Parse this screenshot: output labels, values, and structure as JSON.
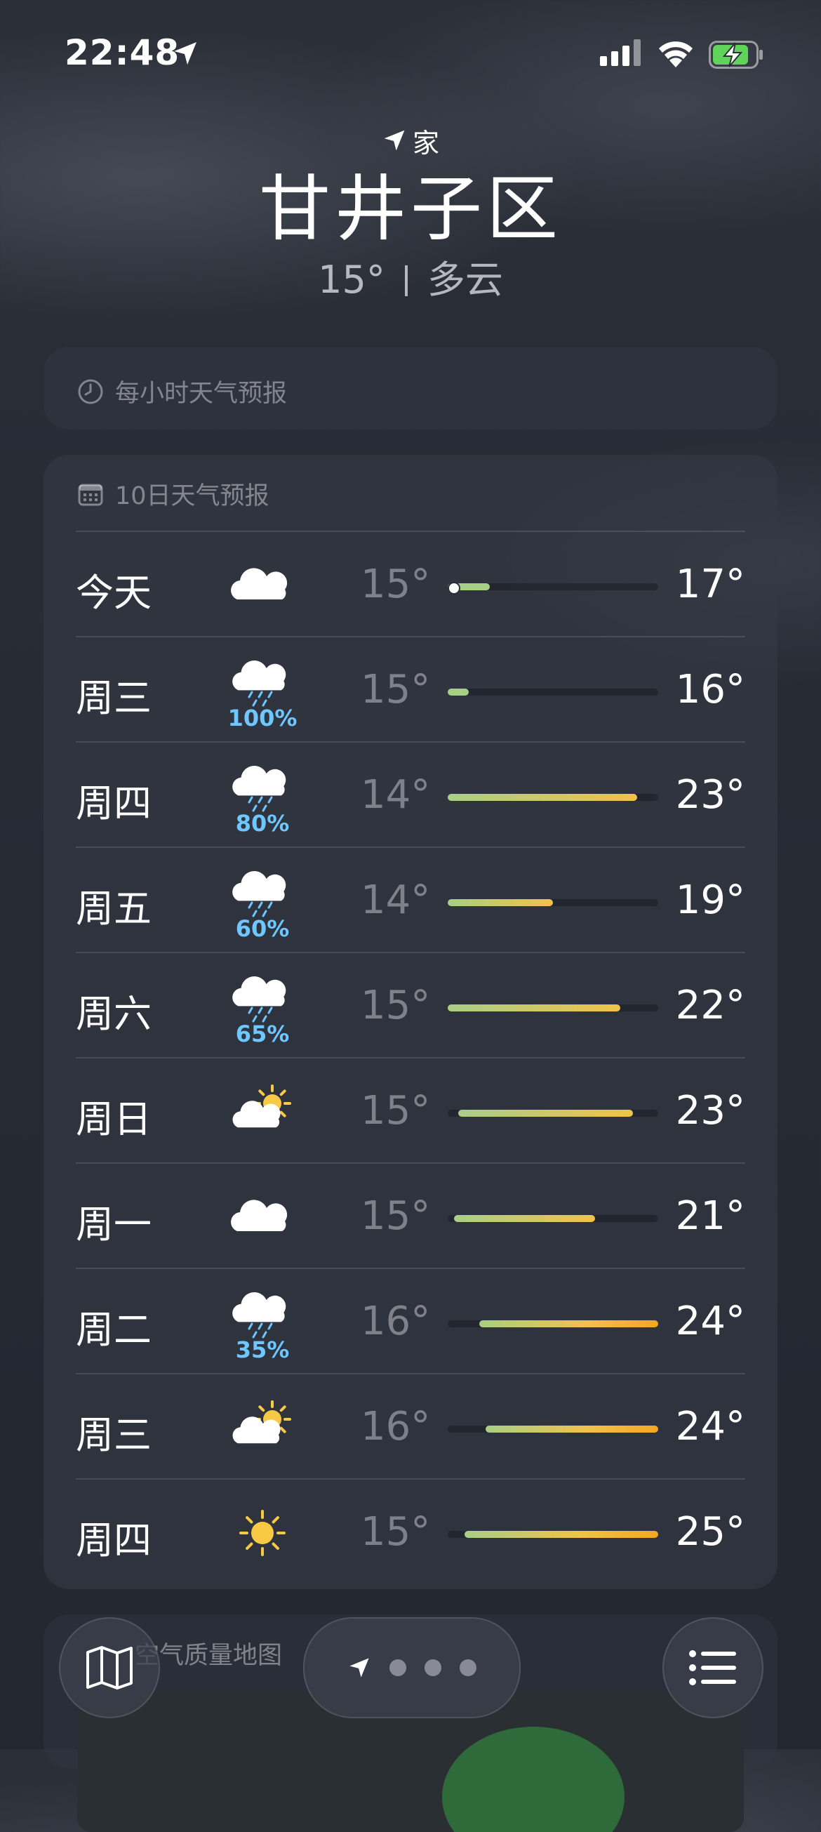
{
  "status_bar": {
    "time": "22:48"
  },
  "header": {
    "location_label": "家",
    "city": "甘井子区",
    "temperature": "15°",
    "condition": "多云"
  },
  "hourly": {
    "title": "每小时天气预报"
  },
  "ten_day": {
    "title": "10日天气预报",
    "rows": [
      {
        "day": "今天",
        "icon": "cloud-icon",
        "precip": "",
        "low": "15°",
        "high": "17°",
        "bar_start": 0.0,
        "bar_end": 0.2,
        "current": 0.0
      },
      {
        "day": "周三",
        "icon": "cloud-rain-icon",
        "precip": "100%",
        "low": "15°",
        "high": "16°",
        "bar_start": 0.0,
        "bar_end": 0.1
      },
      {
        "day": "周四",
        "icon": "cloud-rain-icon",
        "precip": "80%",
        "low": "14°",
        "high": "23°",
        "bar_start": 0.0,
        "bar_end": 0.9
      },
      {
        "day": "周五",
        "icon": "cloud-rain-icon",
        "precip": "60%",
        "low": "14°",
        "high": "19°",
        "bar_start": 0.0,
        "bar_end": 0.5
      },
      {
        "day": "周六",
        "icon": "cloud-rain-icon",
        "precip": "65%",
        "low": "15°",
        "high": "22°",
        "bar_start": 0.0,
        "bar_end": 0.82
      },
      {
        "day": "周日",
        "icon": "partly-sunny-icon",
        "precip": "",
        "low": "15°",
        "high": "23°",
        "bar_start": 0.05,
        "bar_end": 0.88
      },
      {
        "day": "周一",
        "icon": "cloud-icon",
        "precip": "",
        "low": "15°",
        "high": "21°",
        "bar_start": 0.03,
        "bar_end": 0.7
      },
      {
        "day": "周二",
        "icon": "cloud-rain-icon",
        "precip": "35%",
        "low": "16°",
        "high": "24°",
        "bar_start": 0.15,
        "bar_end": 1.0
      },
      {
        "day": "周三",
        "icon": "partly-sunny-icon",
        "precip": "",
        "low": "16°",
        "high": "24°",
        "bar_start": 0.18,
        "bar_end": 1.0
      },
      {
        "day": "周四",
        "icon": "sun-icon",
        "precip": "",
        "low": "15°",
        "high": "25°",
        "bar_start": 0.08,
        "bar_end": 1.0
      }
    ]
  },
  "air_quality": {
    "title": "空气质量地图"
  },
  "toolbar": {
    "map_icon": "map-icon",
    "list_icon": "list-icon"
  },
  "colors": {
    "precip": "#6ec7ff",
    "bar_cool": "#a8cf86",
    "bar_warm": "#f2c14a",
    "bar_hot": "#f5a623"
  }
}
